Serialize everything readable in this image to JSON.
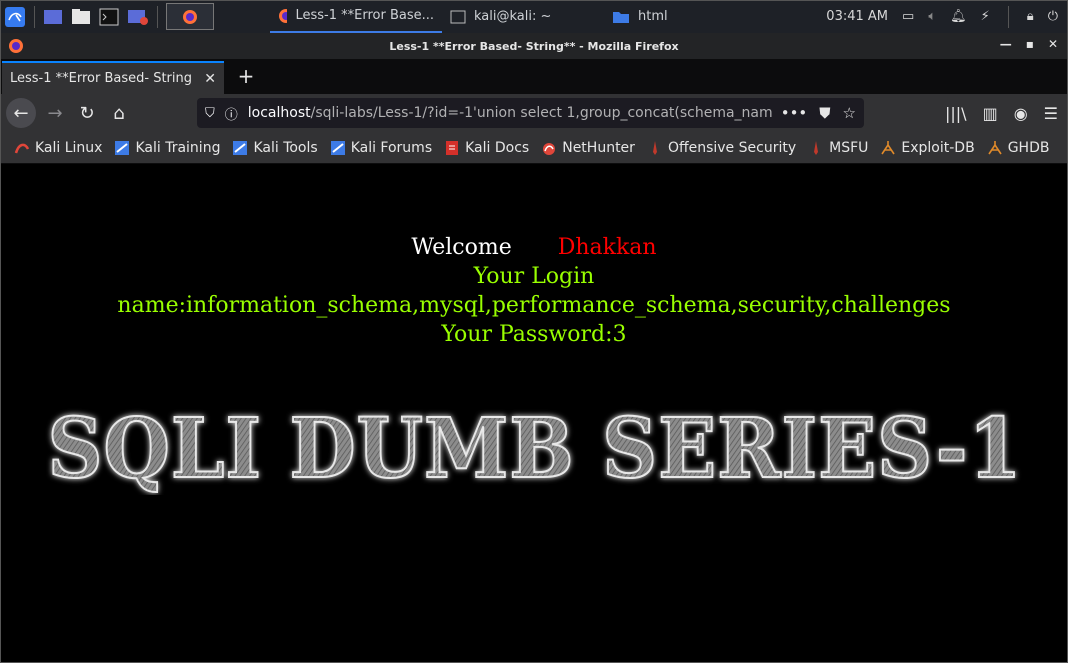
{
  "taskbar": {
    "tasks": [
      {
        "label": "Less-1 **Error Base...",
        "icon": "firefox-icon"
      },
      {
        "label": "kali@kali: ~",
        "icon": "terminal-icon"
      },
      {
        "label": "html",
        "icon": "folder-icon"
      }
    ],
    "clock": "03:41 AM"
  },
  "window": {
    "title": "Less-1 **Error Based- String** - Mozilla Firefox"
  },
  "tabs": [
    {
      "label": "Less-1 **Error Based- String"
    }
  ],
  "urlbar": {
    "host": "localhost",
    "rest": "/sqli-labs/Less-1/?id=-1'union select 1,group_concat(schema_nam"
  },
  "bookmarks": [
    {
      "label": "Kali Linux",
      "icon": "kali-icon",
      "color": "#e0463a"
    },
    {
      "label": "Kali Training",
      "icon": "kali-training-icon",
      "color": "#3d7be6"
    },
    {
      "label": "Kali Tools",
      "icon": "kali-tools-icon",
      "color": "#3d7be6"
    },
    {
      "label": "Kali Forums",
      "icon": "kali-forums-icon",
      "color": "#3d7be6"
    },
    {
      "label": "Kali Docs",
      "icon": "kali-docs-icon",
      "color": "#d4302a"
    },
    {
      "label": "NetHunter",
      "icon": "nethunter-icon",
      "color": "#e0463a"
    },
    {
      "label": "Offensive Security",
      "icon": "offsec-icon",
      "color": "#c0392b"
    },
    {
      "label": "MSFU",
      "icon": "msfu-icon",
      "color": "#c0392b"
    },
    {
      "label": "Exploit-DB",
      "icon": "exploitdb-icon",
      "color": "#e08a2a"
    },
    {
      "label": "GHDB",
      "icon": "ghdb-icon",
      "color": "#e08a2a"
    }
  ],
  "page": {
    "welcome": "Welcome",
    "user": "Dhakkan",
    "login": "Your Login",
    "name": "name:information_schema,mysql,performance_schema,security,challenges",
    "password": "Your Password:3",
    "banner": "SQLI DUMB SERIES-1"
  },
  "colors": {
    "accent": "#0a84ff",
    "green_text": "#99ff00",
    "red_text": "#ff0000"
  }
}
